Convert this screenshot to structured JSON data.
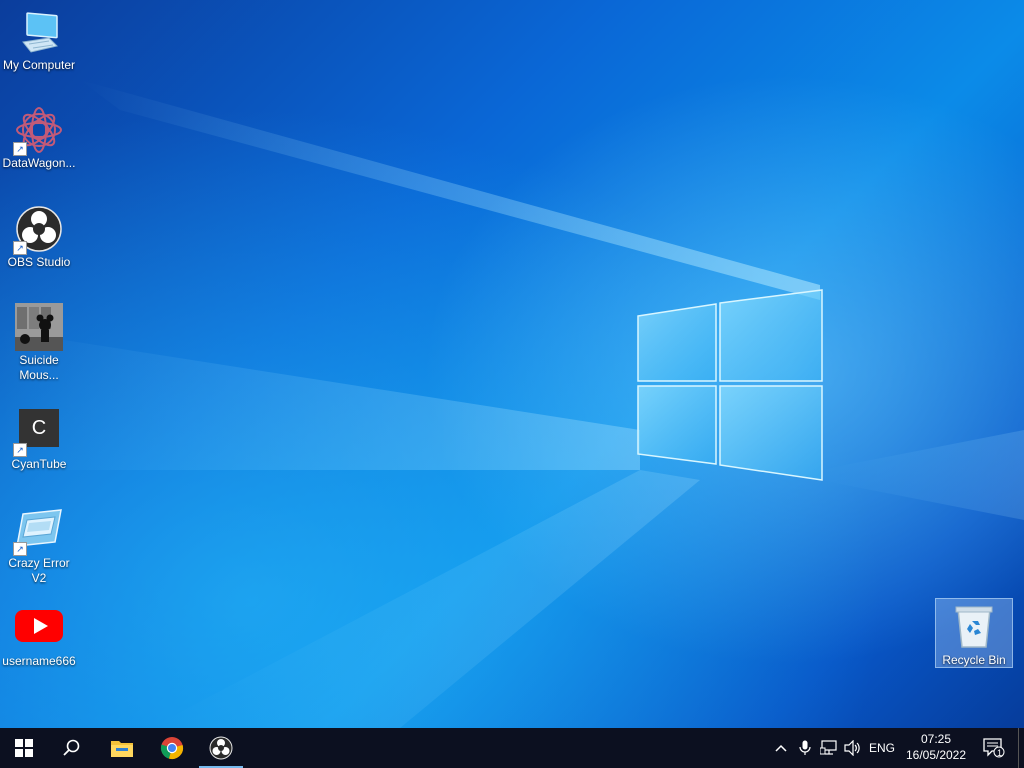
{
  "desktop_icons": [
    {
      "label": "My Computer",
      "icon": "computer-icon"
    },
    {
      "label": "DataWagon...",
      "icon": "datawagon-icon"
    },
    {
      "label": "OBS Studio",
      "icon": "obs-icon"
    },
    {
      "label": "Suicide Mous...",
      "icon": "game-thumbnail-icon"
    },
    {
      "label": "CyanTube",
      "icon": "cyantube-icon",
      "glyph": "C"
    },
    {
      "label": "Crazy Error V2",
      "icon": "error-window-icon"
    },
    {
      "label": "username666",
      "icon": "youtube-icon"
    }
  ],
  "recycle_bin": {
    "label": "Recycle Bin",
    "icon": "recycle-bin-icon"
  },
  "taskbar": {
    "pinned": [
      "start-icon",
      "search-icon",
      "file-explorer-icon",
      "chrome-icon",
      "obs-icon"
    ],
    "active_app": "obs-icon",
    "tray": {
      "language": "ENG",
      "notification_count": "1"
    },
    "clock": {
      "time": "07:25",
      "date": "16/05/2022"
    }
  },
  "colors": {
    "taskbar": "#0c1020",
    "accent": "#76b9ed",
    "wallpaper": "#0a67d6"
  }
}
